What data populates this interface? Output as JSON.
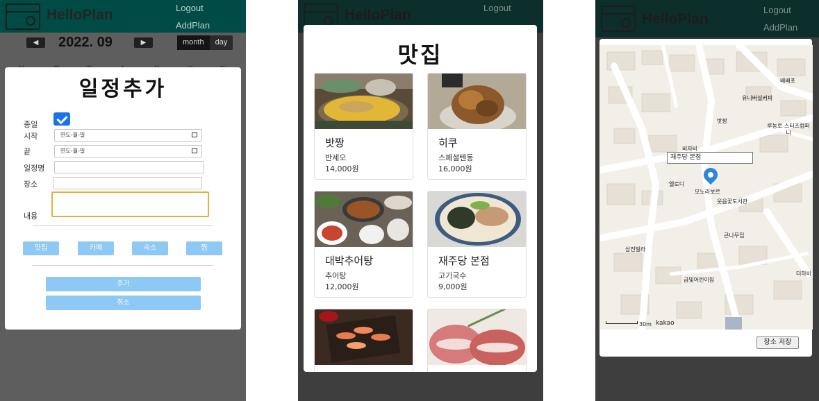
{
  "app": {
    "brand": "HelloPlan",
    "nav_logout": "Logout",
    "nav_addplan": "AddPlan",
    "nav_addplan_partial": "Add Plan"
  },
  "calendar": {
    "year_month": "2022. 09",
    "prev_icon": "◀",
    "next_icon": "▶",
    "view_month": "month",
    "view_day": "day",
    "weekdays": [
      "일",
      "월",
      "화",
      "수",
      "목",
      "금",
      "토"
    ]
  },
  "add_plan_modal": {
    "title": "일정추가",
    "allday_label": "종일",
    "start_label": "시작",
    "end_label": "끝",
    "date_placeholder": "연도-월-일",
    "name_label": "일정명",
    "place_label": "장소",
    "content_label": "내용",
    "categories": [
      "맛집",
      "카페",
      "숙소",
      "찜"
    ],
    "add_button": "추가",
    "cancel_button": "취소"
  },
  "restaurant_modal": {
    "title": "맛집",
    "items": [
      {
        "name": "밧짱",
        "menu": "반세오",
        "price": "14,000원"
      },
      {
        "name": "히쿠",
        "menu": "스페셜텐동",
        "price": "16,000원"
      },
      {
        "name": "대박추어탕",
        "menu": "추어탕",
        "price": "12,000원"
      },
      {
        "name": "재주당 본점",
        "menu": "고기국수",
        "price": "9,000원"
      },
      {
        "name": "",
        "menu": "",
        "price": ""
      },
      {
        "name": "",
        "menu": "",
        "price": ""
      }
    ]
  },
  "map_modal": {
    "selected_place": "재주당 본점",
    "save_button": "장소 저장",
    "scale_label": "30m",
    "provider": "kakao",
    "places": [
      "배배포",
      "유니버설커피",
      "밧짱",
      "루농로 스터즈컴퍼니",
      "비자비",
      "엘로디",
      "모노라보르",
      "웃음꽃도서관",
      "큰나무집",
      "삼진빌라",
      "금빛어린이집",
      "더하비"
    ]
  },
  "colors": {
    "appbar": "#004b45",
    "button_blue": "#8ec8f4",
    "checkbox": "#1a73e8",
    "pin": "#2a86e0"
  }
}
